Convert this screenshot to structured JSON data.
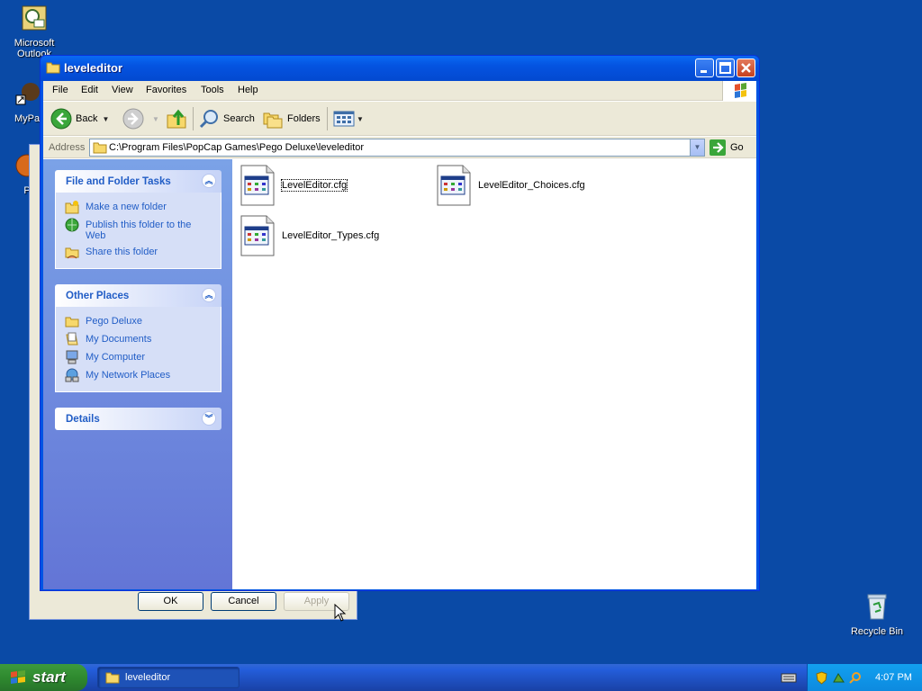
{
  "desktop": {
    "icons": [
      {
        "label": "Microsoft Outlook",
        "icon": "outlook-icon"
      },
      {
        "label": "MyPa",
        "icon": "shortcut-icon"
      },
      {
        "label": "P",
        "icon": "game-icon"
      },
      {
        "label": "Recycle Bin",
        "icon": "recycle-bin-icon"
      }
    ]
  },
  "dialog": {
    "ok_label": "OK",
    "cancel_label": "Cancel",
    "apply_label": "Apply"
  },
  "window": {
    "title": "leveleditor",
    "menu": [
      "File",
      "Edit",
      "View",
      "Favorites",
      "Tools",
      "Help"
    ],
    "toolbar": {
      "back_label": "Back",
      "search_label": "Search",
      "folders_label": "Folders"
    },
    "address": {
      "label": "Address",
      "value": "C:\\Program Files\\PopCap Games\\Pego Deluxe\\leveleditor",
      "go_label": "Go"
    },
    "taskpane": {
      "file_tasks": {
        "title": "File and Folder Tasks",
        "items": [
          "Make a new folder",
          "Publish this folder to the Web",
          "Share this folder"
        ]
      },
      "other_places": {
        "title": "Other Places",
        "items": [
          "Pego Deluxe",
          "My Documents",
          "My Computer",
          "My Network Places"
        ]
      },
      "details": {
        "title": "Details"
      }
    },
    "files": [
      "LevelEditor.cfg",
      "LevelEditor_Choices.cfg",
      "LevelEditor_Types.cfg"
    ]
  },
  "taskbar": {
    "start_label": "start",
    "task_label": "leveleditor",
    "clock": "4:07 PM"
  },
  "colors": {
    "desktop": "#0a4aa6",
    "titlebar": "#0453e0",
    "link": "#215dc6"
  }
}
